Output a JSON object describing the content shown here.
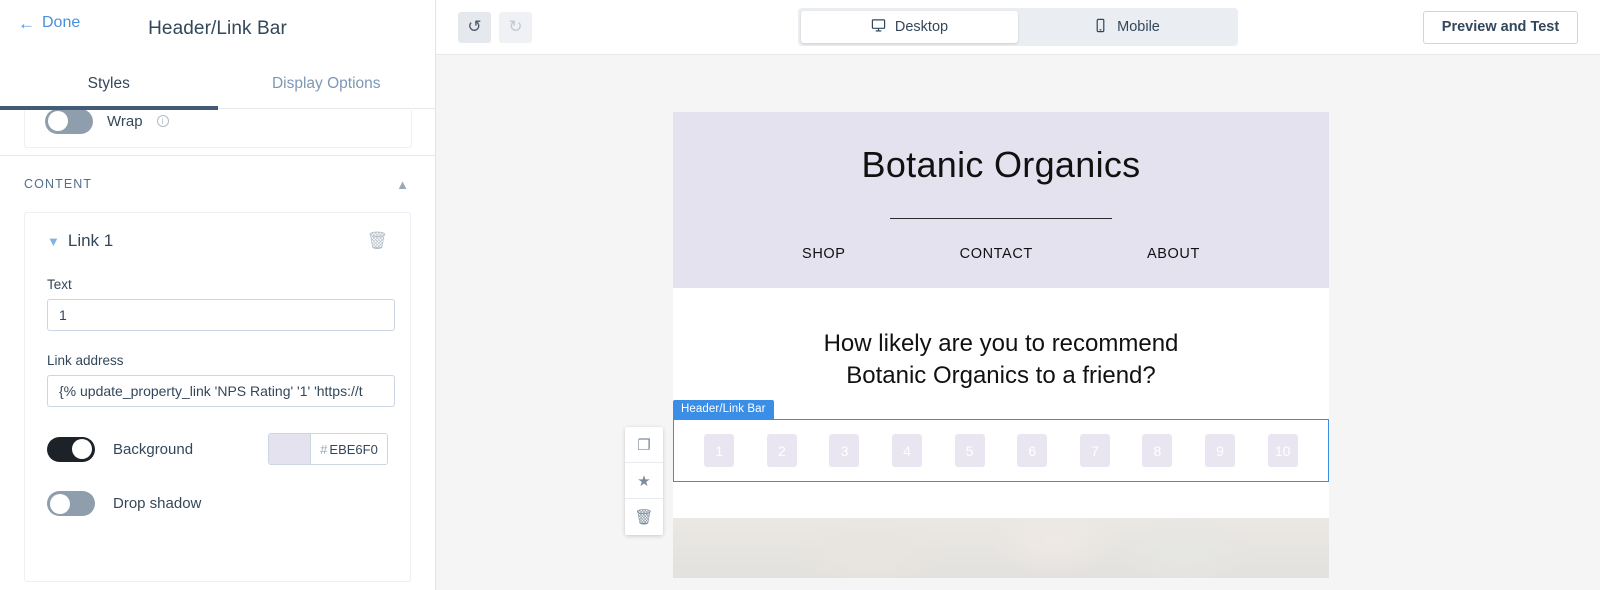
{
  "panel": {
    "done_label": "Done",
    "back_icon": "arrow-left-icon",
    "title": "Header/Link Bar",
    "tabs": [
      {
        "label": "Styles",
        "active": true
      },
      {
        "label": "Display Options",
        "active": false
      }
    ],
    "wrap_row": {
      "label": "Wrap",
      "toggle_state": "off",
      "info_icon": "info-icon"
    },
    "content_section": {
      "title": "CONTENT",
      "collapse_icon": "chevron-up-icon",
      "link": {
        "caret_icon": "chevron-down-icon",
        "title": "Link 1",
        "delete_icon": "trash-icon",
        "text_field": {
          "label": "Text",
          "value": "1"
        },
        "link_field": {
          "label": "Link address",
          "value": "{% update_property_link 'NPS Rating' '1' 'https://t"
        },
        "background": {
          "label": "Background",
          "toggle_state": "on",
          "color_hash": "#",
          "color_value": "EBE6F0",
          "swatch_hex": "#E4E2EE"
        },
        "drop_shadow": {
          "label": "Drop shadow",
          "toggle_state": "off"
        }
      }
    }
  },
  "topbar": {
    "undo_icon": "undo-icon",
    "undo_glyph": "↺",
    "redo_icon": "redo-icon",
    "redo_glyph": "↻",
    "devices": [
      {
        "label": "Desktop",
        "icon": "monitor-icon",
        "selected": true
      },
      {
        "label": "Mobile",
        "icon": "phone-icon",
        "selected": false
      }
    ],
    "preview_label": "Preview and Test"
  },
  "email": {
    "brand": "Botanic Organics",
    "nav": [
      "SHOP",
      "CONTACT",
      "ABOUT"
    ],
    "question_line1": "How likely are you to recommend",
    "question_line2": "Botanic Organics to a friend?",
    "selection_badge": "Header/Link Bar",
    "nps_values": [
      "1",
      "2",
      "3",
      "4",
      "5",
      "6",
      "7",
      "8",
      "9",
      "10"
    ],
    "accent_color": "#3A8EE6",
    "header_bg": "#E4E2EE",
    "chip_bg": "#E9E6F1"
  },
  "float_tools": [
    {
      "name": "duplicate-icon",
      "glyph": "❐"
    },
    {
      "name": "star-icon",
      "glyph": "★"
    },
    {
      "name": "trash-icon",
      "glyph": "🗑"
    }
  ]
}
